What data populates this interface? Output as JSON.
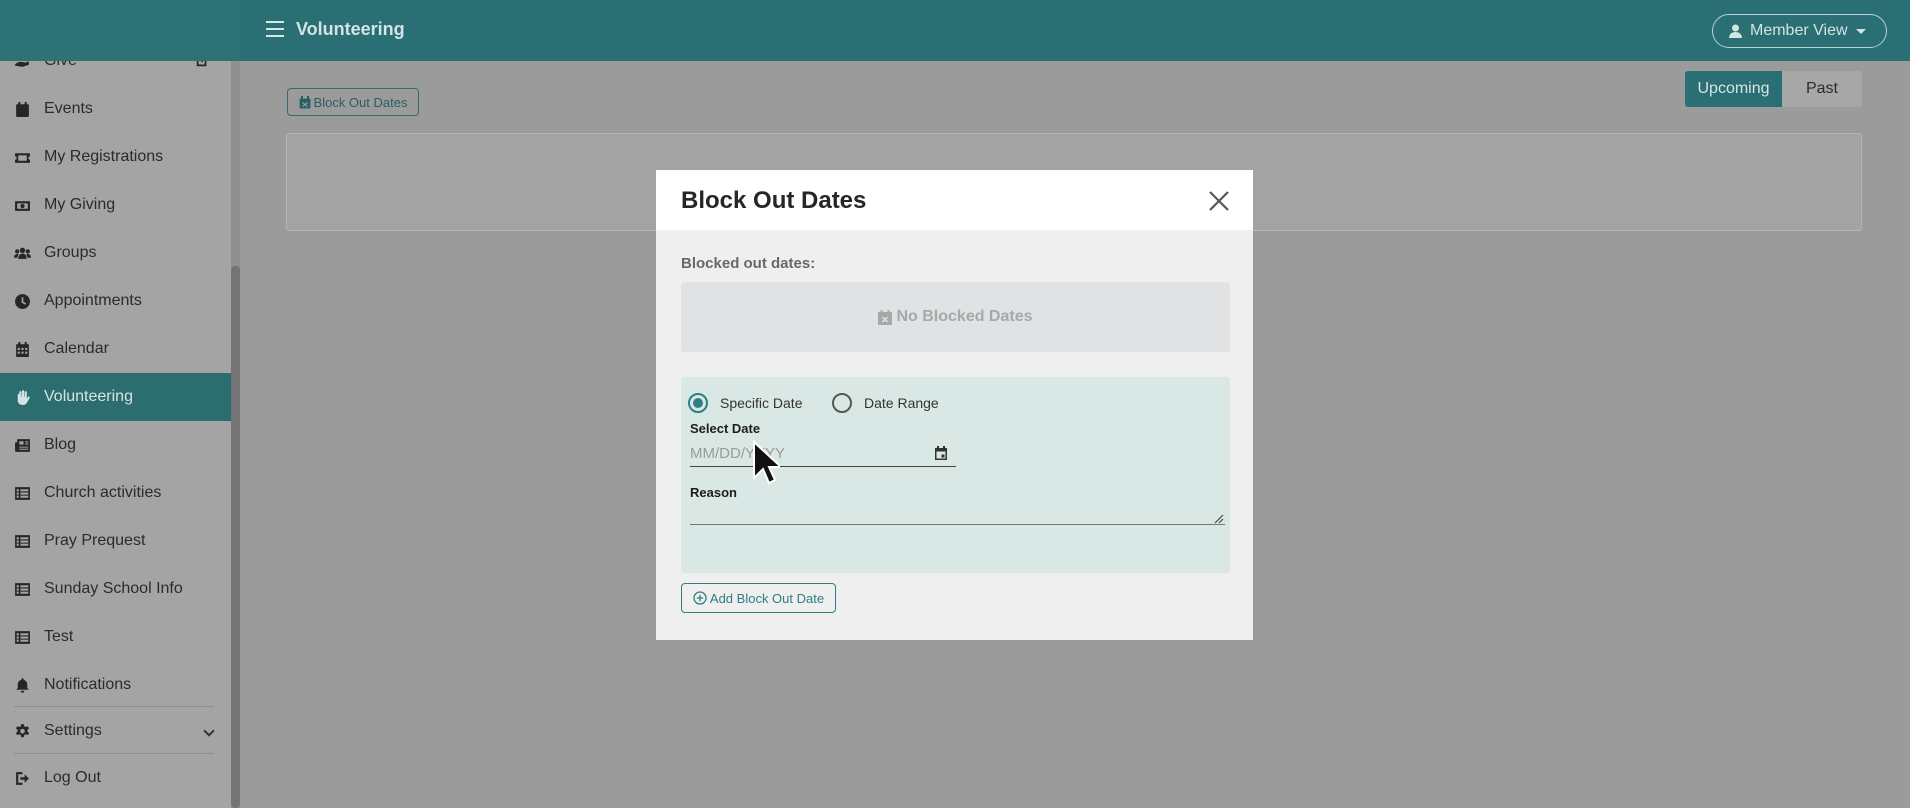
{
  "header": {
    "title": "Volunteering",
    "member_view_label": "Member View"
  },
  "sidebar": {
    "items": [
      {
        "label": "Give",
        "icon": "give-icon"
      },
      {
        "label": "Events",
        "icon": "calendar-icon"
      },
      {
        "label": "My Registrations",
        "icon": "ticket-icon"
      },
      {
        "label": "My Giving",
        "icon": "money-icon"
      },
      {
        "label": "Groups",
        "icon": "users-icon"
      },
      {
        "label": "Appointments",
        "icon": "clock-icon"
      },
      {
        "label": "Calendar",
        "icon": "calendar-grid-icon"
      },
      {
        "label": "Volunteering",
        "icon": "hand-icon",
        "active": true
      },
      {
        "label": "Blog",
        "icon": "newspaper-icon"
      },
      {
        "label": "Church activities",
        "icon": "list-icon"
      },
      {
        "label": "Pray Prequest",
        "icon": "list-icon"
      },
      {
        "label": "Sunday School Info",
        "icon": "list-icon"
      },
      {
        "label": "Test",
        "icon": "list-icon"
      },
      {
        "label": "Notifications",
        "icon": "bell-icon"
      },
      {
        "label": "Settings",
        "icon": "gear-icon"
      },
      {
        "label": "Log Out",
        "icon": "logout-icon"
      }
    ]
  },
  "main": {
    "block_out_button": "Block Out Dates",
    "tabs": {
      "upcoming": "Upcoming",
      "past": "Past"
    }
  },
  "modal": {
    "title": "Block Out Dates",
    "blocked_label": "Blocked out dates:",
    "no_blocked": "No Blocked Dates",
    "radio_specific": "Specific Date",
    "radio_range": "Date Range",
    "select_date_label": "Select Date",
    "date_placeholder": "MM/DD/YYYY",
    "reason_label": "Reason",
    "add_button": "Add Block Out Date"
  },
  "colors": {
    "primary": "#2a6f73",
    "accent": "#2e7f83",
    "overlay": "#9b9b9b"
  }
}
